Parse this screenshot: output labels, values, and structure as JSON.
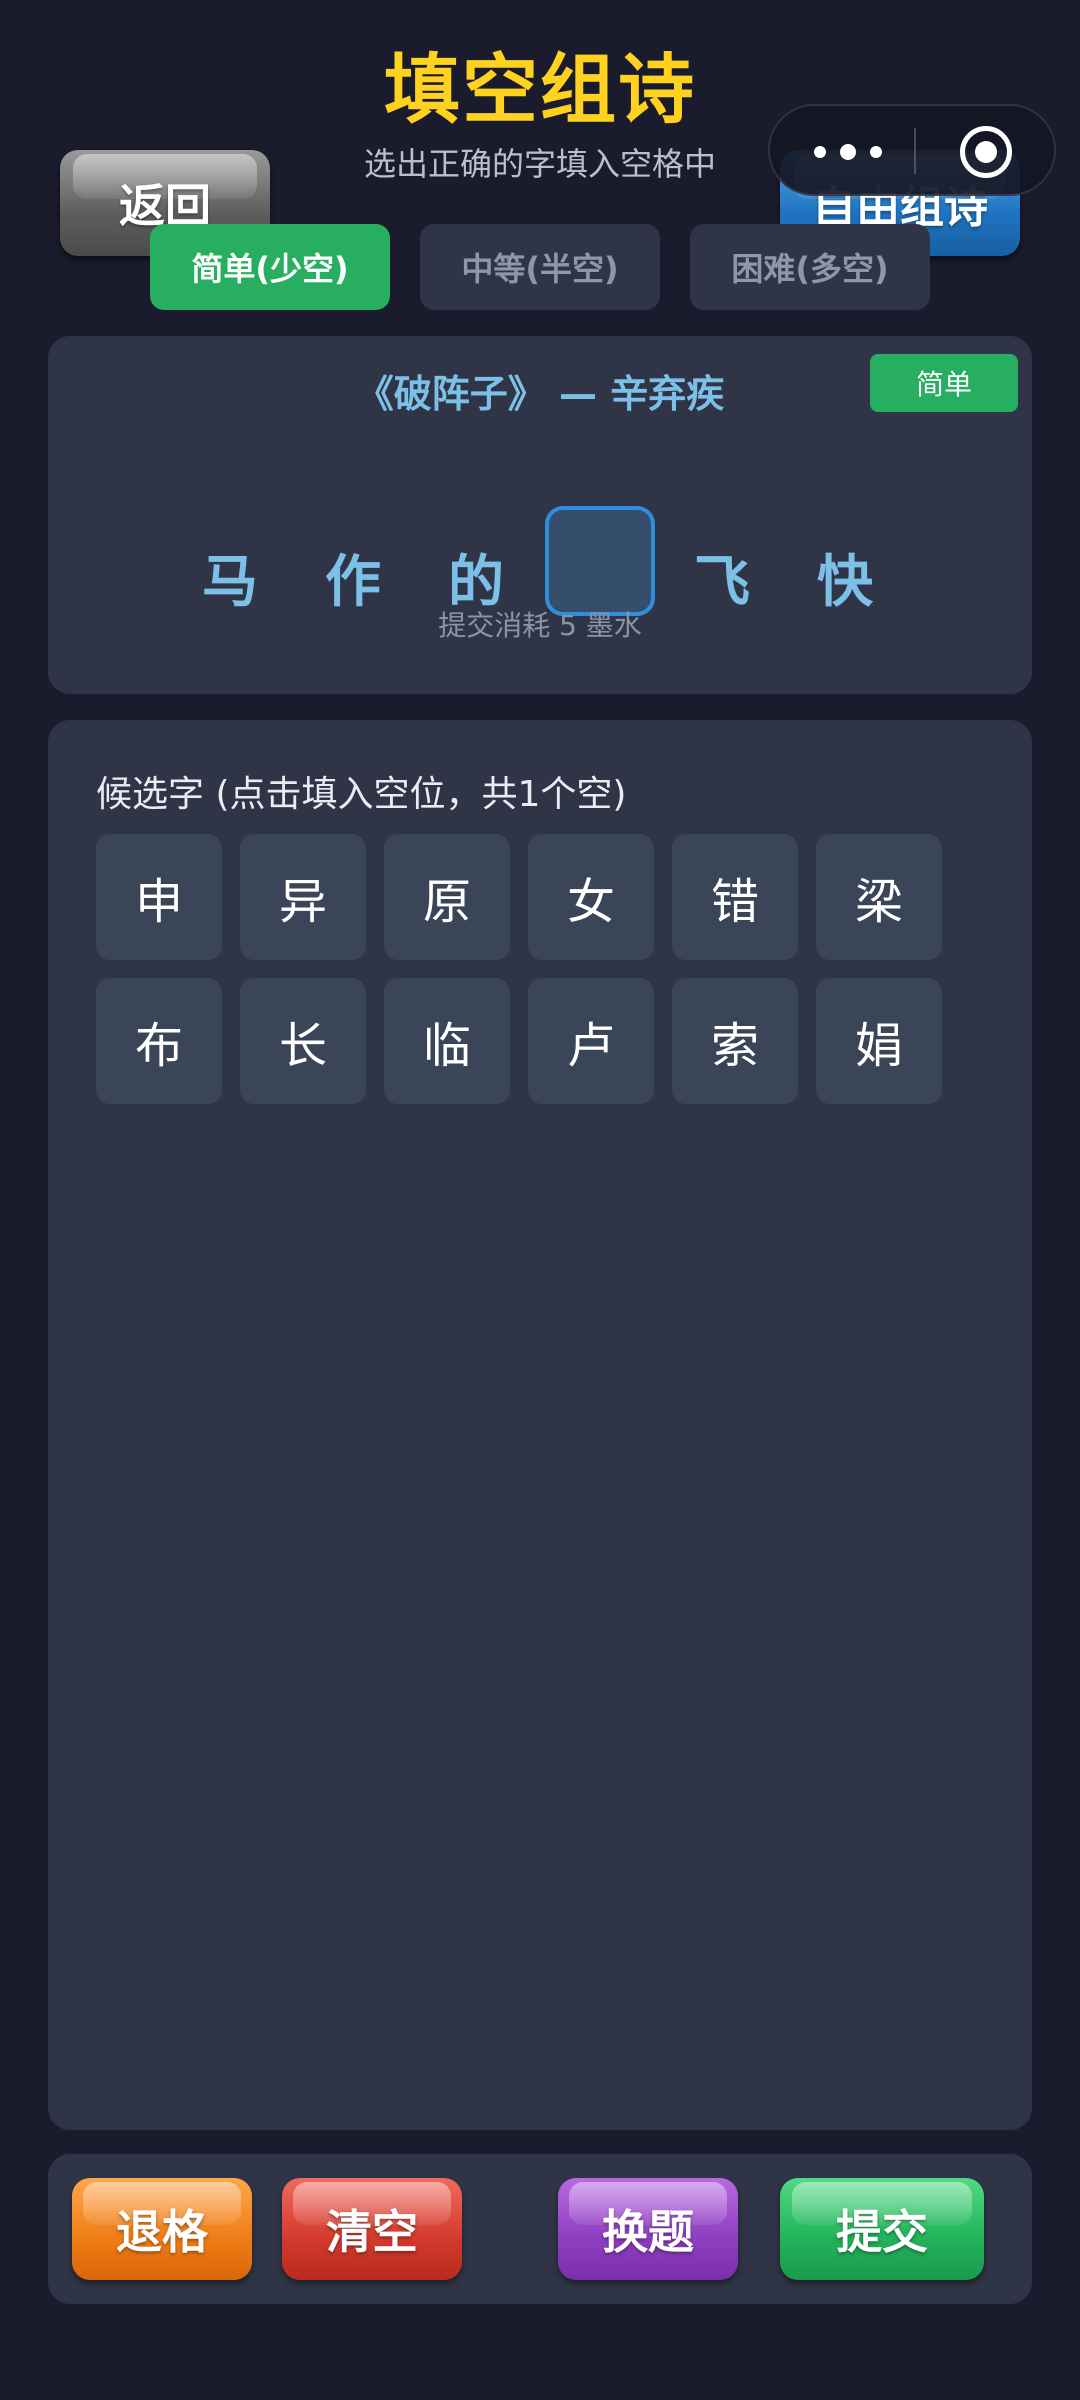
{
  "header": {
    "title": "填空组诗",
    "subtitle": "选出正确的字填入空格中",
    "back_label": "返回",
    "free_mode_label": "自由组诗"
  },
  "capsule": {
    "menu_icon": "more-dots-icon",
    "close_icon": "target-circle-icon"
  },
  "difficulty_tabs": [
    {
      "label": "简单(少空)",
      "active": true
    },
    {
      "label": "中等(半空)",
      "active": false
    },
    {
      "label": "困难(多空)",
      "active": false
    }
  ],
  "poem": {
    "heading": "《破阵子》 — 辛弃疾",
    "level_badge": "简单",
    "chars": [
      "马",
      "作",
      "的",
      "",
      "飞",
      "快"
    ],
    "cost_hint": "提交消耗 5 墨水"
  },
  "candidates": {
    "title": "候选字 (点击填入空位，共1个空)",
    "items": [
      "申",
      "异",
      "原",
      "女",
      "错",
      "梁",
      "布",
      "长",
      "临",
      "卢",
      "索",
      "娟"
    ]
  },
  "actions": {
    "backspace": "退格",
    "clear": "清空",
    "swap": "换题",
    "submit": "提交"
  },
  "colors": {
    "background": "#1b1b2e",
    "title": "#ffd21f",
    "poem_text": "#7cc0e8",
    "active_tab": "#27ae60",
    "panel": "#2f3546"
  }
}
